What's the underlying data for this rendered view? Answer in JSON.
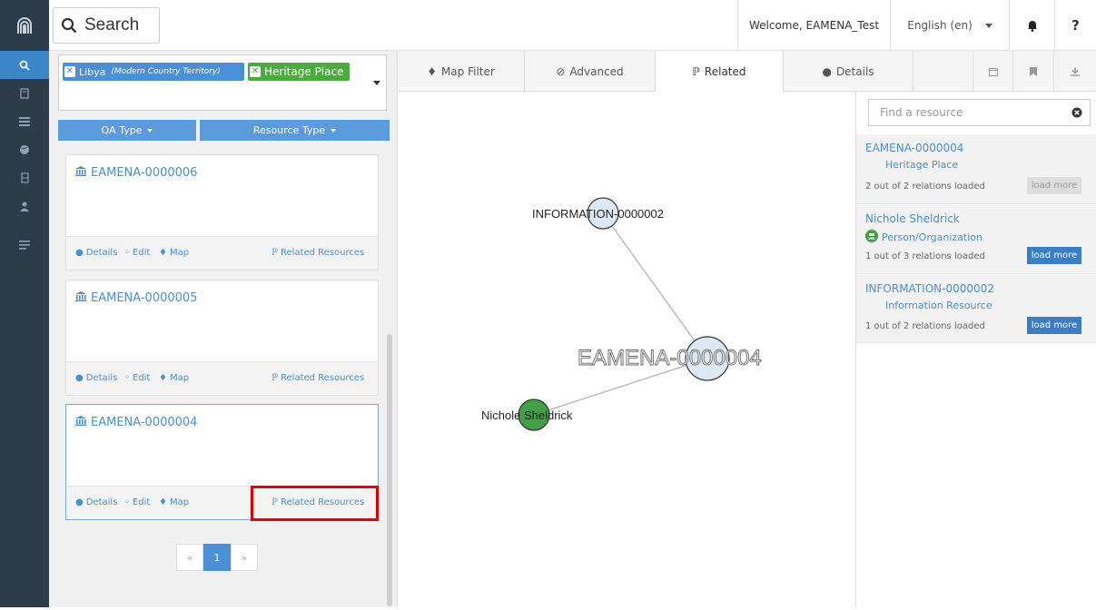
{
  "header": {
    "search_label": "Search",
    "welcome": "Welcome, EAMENA_Test",
    "language": "English (en)",
    "help": "?"
  },
  "sidebar": {
    "icons": [
      "logo-icon",
      "search-icon",
      "book-icon",
      "list-icon",
      "globe-icon",
      "bookmark-icon",
      "user-icon",
      "menu-icon"
    ]
  },
  "filters": {
    "tags": [
      {
        "label": "Libya",
        "qualifier": "(Modern Country Territory)",
        "color": "#4b8fd6"
      },
      {
        "label": "Heritage Place",
        "color": "#4aac3f"
      }
    ],
    "qa_type_label": "QA Type",
    "resource_type_label": "Resource Type"
  },
  "results": [
    {
      "title": "EAMENA-0000006",
      "details": "Details",
      "edit": "Edit",
      "map": "Map",
      "related": "Related Resources"
    },
    {
      "title": "EAMENA-0000005",
      "details": "Details",
      "edit": "Edit",
      "map": "Map",
      "related": "Related Resources"
    },
    {
      "title": "EAMENA-0000004",
      "details": "Details",
      "edit": "Edit",
      "map": "Map",
      "related": "Related Resources"
    }
  ],
  "pagination": {
    "prev": "«",
    "current": "1",
    "next": "»"
  },
  "tabs": [
    {
      "label": "Map Filter"
    },
    {
      "label": "Advanced"
    },
    {
      "label": "Related"
    },
    {
      "label": "Details"
    }
  ],
  "graph": {
    "center_label": "EAMENA-0000004",
    "info_label": "INFORMATION-0000002",
    "person_label": "Nichole Sheldrick",
    "node_colors": {
      "resource": "#dce9f5",
      "person": "#43a047"
    }
  },
  "related_panel": {
    "search_placeholder": "Find a resource",
    "items": [
      {
        "name": "EAMENA-0000004",
        "type": "Heritage Place",
        "count": "2 out of 2 relations loaded",
        "load_more": "load more",
        "enabled": false
      },
      {
        "name": "Nichole Sheldrick",
        "type": "Person/Organization",
        "count": "1 out of 3 relations loaded",
        "load_more": "load more",
        "enabled": true
      },
      {
        "name": "INFORMATION-0000002",
        "type": "Information Resource",
        "count": "1 out of 2 relations loaded",
        "load_more": "load more",
        "enabled": true
      }
    ]
  }
}
